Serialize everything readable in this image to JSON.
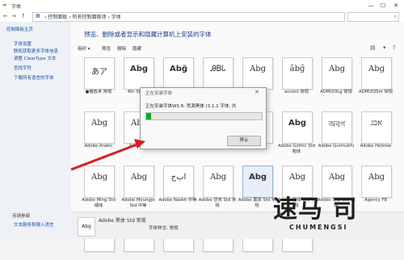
{
  "window": {
    "title": "字体",
    "controls": [
      "—",
      "☐",
      "✕"
    ]
  },
  "address": {
    "breadcrumbs": "› 控制面板 › 所有控制面板项 › 字体",
    "back": "←",
    "forward": "→",
    "up": "↑",
    "search_placeholder": ""
  },
  "sidebar": {
    "home": "控制面板主页",
    "links": [
      "字体设置",
      "联机获取更多字体信息",
      "调整 ClearType 文本",
      "查找字符",
      "下载所有语言的字体"
    ],
    "see_also_heading": "另请参阅",
    "see_also": [
      "文本服务和输入语言"
    ]
  },
  "main": {
    "title": "预览、删除或者显示和隐藏计算机上安装的字体",
    "toolbar": [
      "组织 ▾",
      "预览",
      "删除",
      "隐藏"
    ]
  },
  "tiles": [
    {
      "sample": "あア",
      "label": "●播放术 常规",
      "bold": false,
      "stack": false
    },
    {
      "sample": "Abg",
      "label": "4th Street",
      "bold": true,
      "stack": false
    },
    {
      "sample": "Abğ",
      "label": "",
      "bold": true,
      "stack": false
    },
    {
      "sample": "ᎯᏴᏓ",
      "label": "",
      "bold": false,
      "stack": false
    },
    {
      "sample": "Abg",
      "label": "",
      "bold": false,
      "stack": false
    },
    {
      "sample": "ãbğ",
      "label": "accent 常规",
      "bold": false,
      "stack": false
    },
    {
      "sample": "Abg",
      "label": "ADMUI3Lg 常规",
      "bold": false,
      "stack": false
    },
    {
      "sample": "Abg",
      "label": "ADMUI3Sm 常规",
      "bold": false,
      "stack": false
    },
    {
      "sample": "Abg",
      "label": "Adobe Arabic",
      "bold": false,
      "stack": true
    },
    {
      "sample": "Abg",
      "label": "Adobe C",
      "bold": false,
      "stack": true
    },
    {
      "sample": "",
      "label": "",
      "bold": false,
      "stack": true
    },
    {
      "sample": "",
      "label": "",
      "bold": false,
      "stack": true
    },
    {
      "sample": "",
      "label": "",
      "bold": false,
      "stack": true
    },
    {
      "sample": "Abg",
      "label": "Adobe Gothic Std 粗体",
      "bold": true,
      "stack": false
    },
    {
      "sample": "অবগ",
      "label": "Adobe Gurmukhi",
      "bold": false,
      "stack": true
    },
    {
      "sample": "אבג",
      "label": "Adobe Hebrew",
      "bold": false,
      "stack": true
    },
    {
      "sample": "Abg",
      "label": "Adobe Ming Std 细体",
      "bold": false,
      "stack": false
    },
    {
      "sample": "Abg",
      "label": "Adobe Myungjo Std 中等",
      "bold": false,
      "stack": false
    },
    {
      "sample": "ﺍﺏﺝ",
      "label": "Adobe Naskh 中等",
      "bold": false,
      "stack": false
    },
    {
      "sample": "Abg",
      "label": "Adobe 仿宋 Std 常规",
      "bold": false,
      "stack": false
    },
    {
      "sample": "Abg",
      "label": "Adobe 黑体 Std 常规",
      "bold": true,
      "stack": false
    },
    {
      "sample": "Abg",
      "label": "Adobe 楷体 Std 常规",
      "bold": false,
      "stack": false
    },
    {
      "sample": "Abg",
      "label": "Adobe 宋体 Std 细体",
      "bold": false,
      "stack": false
    },
    {
      "sample": "Abg",
      "label": "Agency FB",
      "bold": false,
      "stack": true
    },
    {
      "sample": "",
      "label": "",
      "bold": false,
      "stack": false
    },
    {
      "sample": "",
      "label": "",
      "bold": false,
      "stack": false
    },
    {
      "sample": "",
      "label": "",
      "bold": false,
      "stack": false
    },
    {
      "sample": "",
      "label": "",
      "bold": false,
      "stack": false
    },
    {
      "sample": "",
      "label": "",
      "bold": false,
      "stack": false
    },
    {
      "sample": "",
      "label": "",
      "bold": false,
      "stack": false
    }
  ],
  "dialog": {
    "title": "正在安装字体",
    "message": "正在安装字体WS 8: 思源黑体 (3.1.1 字体, 共",
    "progress_fraction": 0.04,
    "stop_label": "停止",
    "close": "✕",
    "progress_color": "#06b025"
  },
  "details": {
    "icon_text": "Abg",
    "name": "Adobe 黑体 Std 常规",
    "subtitle": "字体样式: 常规"
  },
  "watermark": {
    "text": "速马 司",
    "sub": "CHUMENGSI"
  },
  "colors": {
    "arrow": "#d42020",
    "link": "#1a4fa3"
  }
}
